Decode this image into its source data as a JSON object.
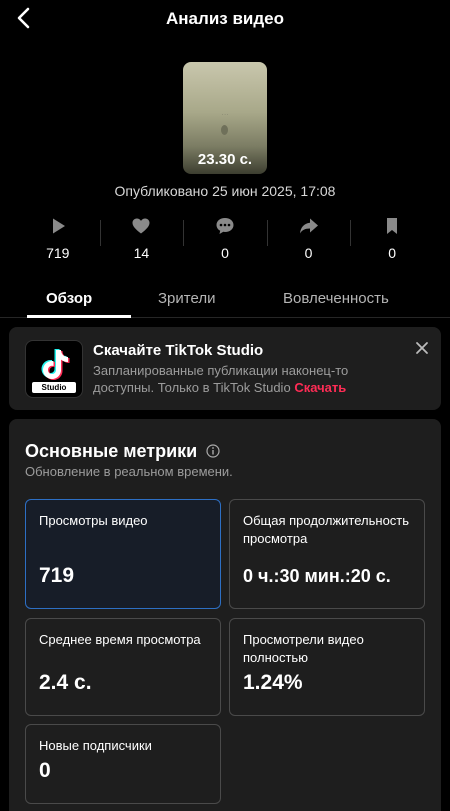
{
  "header": {
    "title": "Анализ видео"
  },
  "video": {
    "duration": "23.30 с.",
    "published": "Опубликовано 25 июн 2025, 17:08"
  },
  "stats": [
    {
      "icon": "play-icon",
      "value": "719"
    },
    {
      "icon": "heart-icon",
      "value": "14"
    },
    {
      "icon": "comment-icon",
      "value": "0"
    },
    {
      "icon": "share-icon",
      "value": "0"
    },
    {
      "icon": "bookmark-icon",
      "value": "0"
    }
  ],
  "tabs": [
    {
      "label": "Обзор",
      "active": true
    },
    {
      "label": "Зрители",
      "active": false
    },
    {
      "label": "Вовлеченность",
      "active": false
    }
  ],
  "promo": {
    "title": "Скачайте TikTok Studio",
    "text": "Запланированные публикации наконец-то доступны. Только в TikTok Studio",
    "link": "Скачать",
    "logo_label": "Studio"
  },
  "metrics": {
    "title": "Основные метрики",
    "subtitle": "Обновление в реальном времени.",
    "cards": [
      {
        "label": "Просмотры видео",
        "value": "719"
      },
      {
        "label": "Общая продолжительность просмотра",
        "value": "0 ч.:30 мин.:20 с."
      },
      {
        "label": "Среднее время просмотра",
        "value": "2.4 с."
      },
      {
        "label": "Просмотрели видео полностью",
        "value": "1.24%"
      },
      {
        "label": "Новые подписчики",
        "value": "0"
      }
    ]
  },
  "colors": {
    "accent": "#fe2c55",
    "selected_border": "#2d6fc4",
    "card_bg": "#1e1e1e"
  }
}
